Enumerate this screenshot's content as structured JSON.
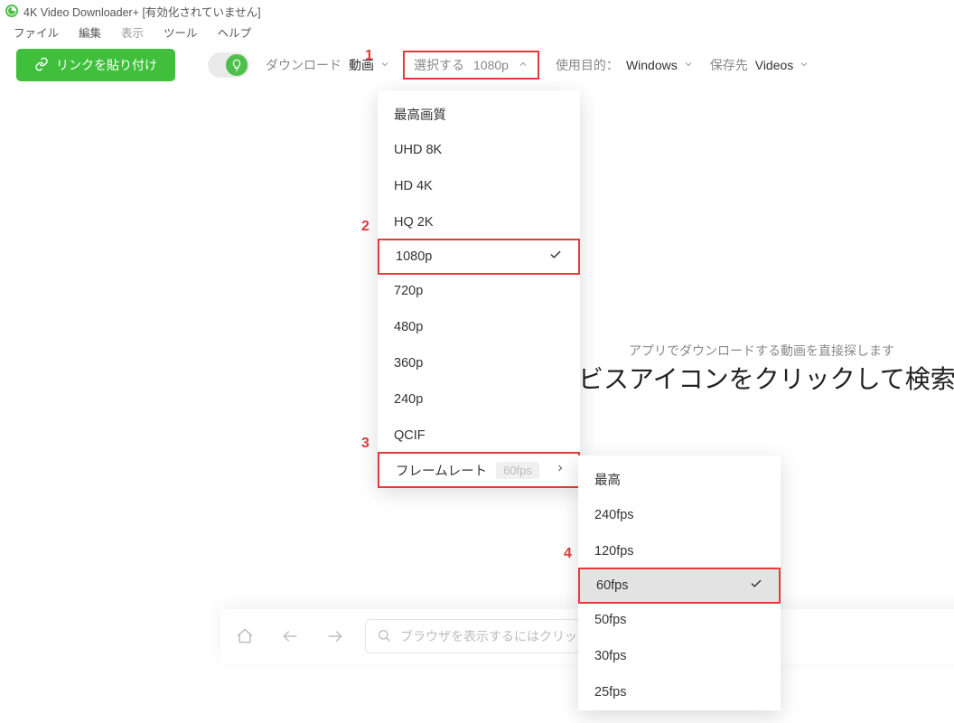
{
  "window": {
    "title": "4K Video Downloader+ [有効化されていません]"
  },
  "menu": {
    "items": [
      "ファイル",
      "編集",
      "表示",
      "ツール",
      "ヘルプ"
    ]
  },
  "toolbar": {
    "paste_label": "リンクを貼り付け",
    "download": {
      "label": "ダウンロード",
      "value": "動画"
    },
    "quality": {
      "label": "選択する",
      "value": "1080p"
    },
    "purpose": {
      "label": "使用目的：",
      "value": "Windows"
    },
    "saveto": {
      "label": "保存先",
      "value": "Videos"
    }
  },
  "quality_menu": {
    "items": [
      {
        "label": "最高画質"
      },
      {
        "label": "UHD 8K"
      },
      {
        "label": "HD 4K"
      },
      {
        "label": "HQ 2K"
      },
      {
        "label": "1080p",
        "selected": true
      },
      {
        "label": "720p"
      },
      {
        "label": "480p"
      },
      {
        "label": "360p"
      },
      {
        "label": "240p"
      },
      {
        "label": "QCIF"
      }
    ],
    "framerate": {
      "label": "フレームレート",
      "value": "60fps"
    }
  },
  "fps_menu": {
    "items": [
      {
        "label": "最高"
      },
      {
        "label": "240fps"
      },
      {
        "label": "120fps"
      },
      {
        "label": "60fps",
        "selected": true
      },
      {
        "label": "50fps"
      },
      {
        "label": "30fps"
      },
      {
        "label": "25fps"
      }
    ]
  },
  "background": {
    "line1": "アプリでダウンロードする動画を直接探します",
    "line2": "ビスアイコンをクリックして検索を開始"
  },
  "browser_bar": {
    "placeholder": "ブラウザを表示するにはクリッ"
  },
  "annotations": {
    "a1": "1",
    "a2": "2",
    "a3": "3",
    "a4": "4"
  }
}
